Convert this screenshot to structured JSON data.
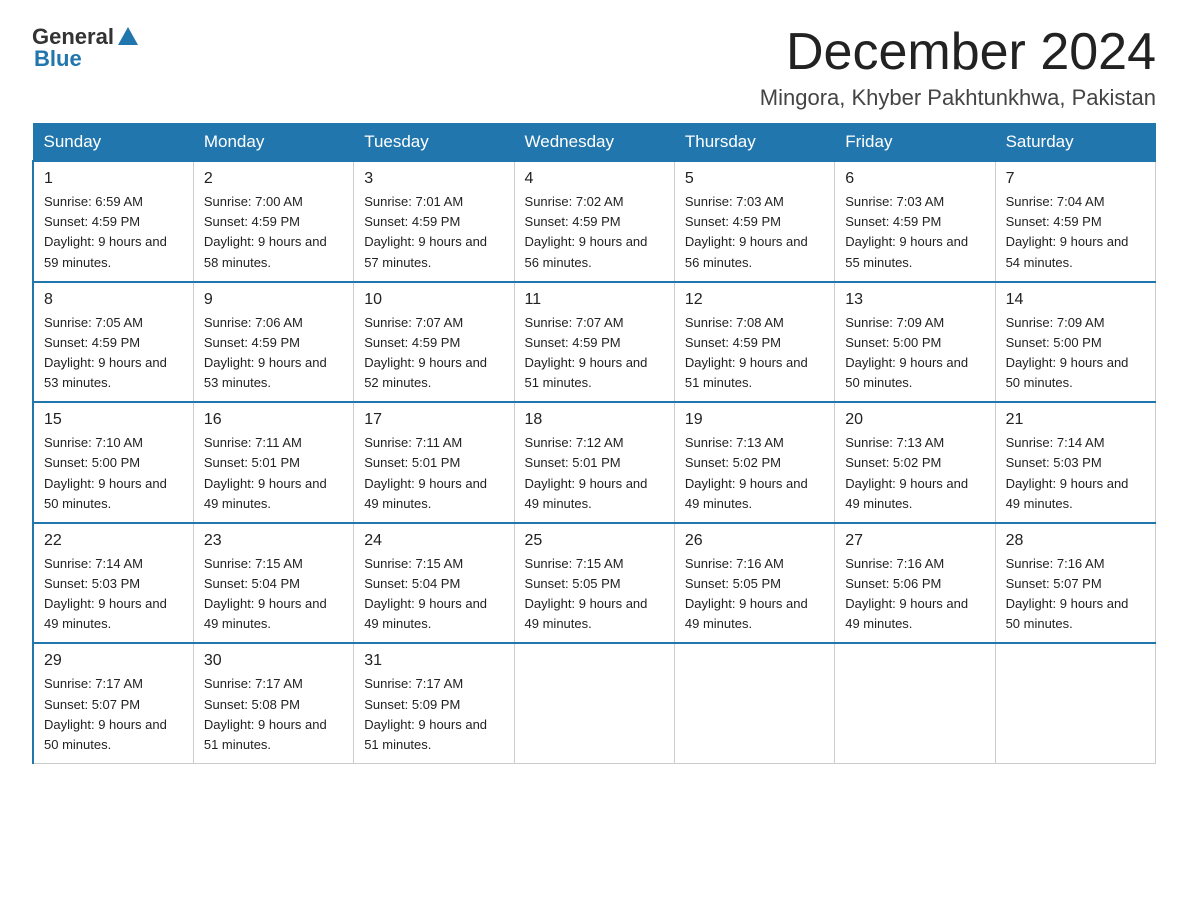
{
  "logo": {
    "general": "General",
    "blue": "Blue"
  },
  "title": {
    "month": "December 2024",
    "location": "Mingora, Khyber Pakhtunkhwa, Pakistan"
  },
  "headers": [
    "Sunday",
    "Monday",
    "Tuesday",
    "Wednesday",
    "Thursday",
    "Friday",
    "Saturday"
  ],
  "weeks": [
    [
      {
        "day": "1",
        "sunrise": "6:59 AM",
        "sunset": "4:59 PM",
        "daylight": "9 hours and 59 minutes."
      },
      {
        "day": "2",
        "sunrise": "7:00 AM",
        "sunset": "4:59 PM",
        "daylight": "9 hours and 58 minutes."
      },
      {
        "day": "3",
        "sunrise": "7:01 AM",
        "sunset": "4:59 PM",
        "daylight": "9 hours and 57 minutes."
      },
      {
        "day": "4",
        "sunrise": "7:02 AM",
        "sunset": "4:59 PM",
        "daylight": "9 hours and 56 minutes."
      },
      {
        "day": "5",
        "sunrise": "7:03 AM",
        "sunset": "4:59 PM",
        "daylight": "9 hours and 56 minutes."
      },
      {
        "day": "6",
        "sunrise": "7:03 AM",
        "sunset": "4:59 PM",
        "daylight": "9 hours and 55 minutes."
      },
      {
        "day": "7",
        "sunrise": "7:04 AM",
        "sunset": "4:59 PM",
        "daylight": "9 hours and 54 minutes."
      }
    ],
    [
      {
        "day": "8",
        "sunrise": "7:05 AM",
        "sunset": "4:59 PM",
        "daylight": "9 hours and 53 minutes."
      },
      {
        "day": "9",
        "sunrise": "7:06 AM",
        "sunset": "4:59 PM",
        "daylight": "9 hours and 53 minutes."
      },
      {
        "day": "10",
        "sunrise": "7:07 AM",
        "sunset": "4:59 PM",
        "daylight": "9 hours and 52 minutes."
      },
      {
        "day": "11",
        "sunrise": "7:07 AM",
        "sunset": "4:59 PM",
        "daylight": "9 hours and 51 minutes."
      },
      {
        "day": "12",
        "sunrise": "7:08 AM",
        "sunset": "4:59 PM",
        "daylight": "9 hours and 51 minutes."
      },
      {
        "day": "13",
        "sunrise": "7:09 AM",
        "sunset": "5:00 PM",
        "daylight": "9 hours and 50 minutes."
      },
      {
        "day": "14",
        "sunrise": "7:09 AM",
        "sunset": "5:00 PM",
        "daylight": "9 hours and 50 minutes."
      }
    ],
    [
      {
        "day": "15",
        "sunrise": "7:10 AM",
        "sunset": "5:00 PM",
        "daylight": "9 hours and 50 minutes."
      },
      {
        "day": "16",
        "sunrise": "7:11 AM",
        "sunset": "5:01 PM",
        "daylight": "9 hours and 49 minutes."
      },
      {
        "day": "17",
        "sunrise": "7:11 AM",
        "sunset": "5:01 PM",
        "daylight": "9 hours and 49 minutes."
      },
      {
        "day": "18",
        "sunrise": "7:12 AM",
        "sunset": "5:01 PM",
        "daylight": "9 hours and 49 minutes."
      },
      {
        "day": "19",
        "sunrise": "7:13 AM",
        "sunset": "5:02 PM",
        "daylight": "9 hours and 49 minutes."
      },
      {
        "day": "20",
        "sunrise": "7:13 AM",
        "sunset": "5:02 PM",
        "daylight": "9 hours and 49 minutes."
      },
      {
        "day": "21",
        "sunrise": "7:14 AM",
        "sunset": "5:03 PM",
        "daylight": "9 hours and 49 minutes."
      }
    ],
    [
      {
        "day": "22",
        "sunrise": "7:14 AM",
        "sunset": "5:03 PM",
        "daylight": "9 hours and 49 minutes."
      },
      {
        "day": "23",
        "sunrise": "7:15 AM",
        "sunset": "5:04 PM",
        "daylight": "9 hours and 49 minutes."
      },
      {
        "day": "24",
        "sunrise": "7:15 AM",
        "sunset": "5:04 PM",
        "daylight": "9 hours and 49 minutes."
      },
      {
        "day": "25",
        "sunrise": "7:15 AM",
        "sunset": "5:05 PM",
        "daylight": "9 hours and 49 minutes."
      },
      {
        "day": "26",
        "sunrise": "7:16 AM",
        "sunset": "5:05 PM",
        "daylight": "9 hours and 49 minutes."
      },
      {
        "day": "27",
        "sunrise": "7:16 AM",
        "sunset": "5:06 PM",
        "daylight": "9 hours and 49 minutes."
      },
      {
        "day": "28",
        "sunrise": "7:16 AM",
        "sunset": "5:07 PM",
        "daylight": "9 hours and 50 minutes."
      }
    ],
    [
      {
        "day": "29",
        "sunrise": "7:17 AM",
        "sunset": "5:07 PM",
        "daylight": "9 hours and 50 minutes."
      },
      {
        "day": "30",
        "sunrise": "7:17 AM",
        "sunset": "5:08 PM",
        "daylight": "9 hours and 51 minutes."
      },
      {
        "day": "31",
        "sunrise": "7:17 AM",
        "sunset": "5:09 PM",
        "daylight": "9 hours and 51 minutes."
      },
      null,
      null,
      null,
      null
    ]
  ],
  "colors": {
    "header_bg": "#2176ae",
    "header_text": "#ffffff",
    "border_accent": "#2176ae"
  }
}
